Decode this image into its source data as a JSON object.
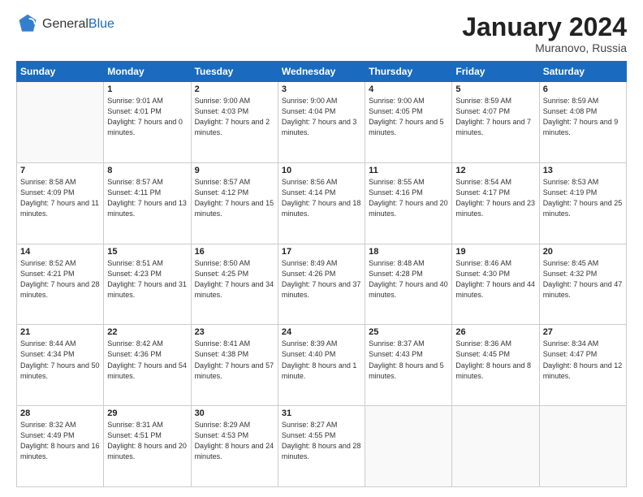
{
  "logo": {
    "general": "General",
    "blue": "Blue"
  },
  "header": {
    "month_year": "January 2024",
    "location": "Muranovo, Russia"
  },
  "weekdays": [
    "Sunday",
    "Monday",
    "Tuesday",
    "Wednesday",
    "Thursday",
    "Friday",
    "Saturday"
  ],
  "weeks": [
    [
      {
        "day": "",
        "sunrise": "",
        "sunset": "",
        "daylight": ""
      },
      {
        "day": "1",
        "sunrise": "Sunrise: 9:01 AM",
        "sunset": "Sunset: 4:01 PM",
        "daylight": "Daylight: 7 hours and 0 minutes."
      },
      {
        "day": "2",
        "sunrise": "Sunrise: 9:00 AM",
        "sunset": "Sunset: 4:03 PM",
        "daylight": "Daylight: 7 hours and 2 minutes."
      },
      {
        "day": "3",
        "sunrise": "Sunrise: 9:00 AM",
        "sunset": "Sunset: 4:04 PM",
        "daylight": "Daylight: 7 hours and 3 minutes."
      },
      {
        "day": "4",
        "sunrise": "Sunrise: 9:00 AM",
        "sunset": "Sunset: 4:05 PM",
        "daylight": "Daylight: 7 hours and 5 minutes."
      },
      {
        "day": "5",
        "sunrise": "Sunrise: 8:59 AM",
        "sunset": "Sunset: 4:07 PM",
        "daylight": "Daylight: 7 hours and 7 minutes."
      },
      {
        "day": "6",
        "sunrise": "Sunrise: 8:59 AM",
        "sunset": "Sunset: 4:08 PM",
        "daylight": "Daylight: 7 hours and 9 minutes."
      }
    ],
    [
      {
        "day": "7",
        "sunrise": "Sunrise: 8:58 AM",
        "sunset": "Sunset: 4:09 PM",
        "daylight": "Daylight: 7 hours and 11 minutes."
      },
      {
        "day": "8",
        "sunrise": "Sunrise: 8:57 AM",
        "sunset": "Sunset: 4:11 PM",
        "daylight": "Daylight: 7 hours and 13 minutes."
      },
      {
        "day": "9",
        "sunrise": "Sunrise: 8:57 AM",
        "sunset": "Sunset: 4:12 PM",
        "daylight": "Daylight: 7 hours and 15 minutes."
      },
      {
        "day": "10",
        "sunrise": "Sunrise: 8:56 AM",
        "sunset": "Sunset: 4:14 PM",
        "daylight": "Daylight: 7 hours and 18 minutes."
      },
      {
        "day": "11",
        "sunrise": "Sunrise: 8:55 AM",
        "sunset": "Sunset: 4:16 PM",
        "daylight": "Daylight: 7 hours and 20 minutes."
      },
      {
        "day": "12",
        "sunrise": "Sunrise: 8:54 AM",
        "sunset": "Sunset: 4:17 PM",
        "daylight": "Daylight: 7 hours and 23 minutes."
      },
      {
        "day": "13",
        "sunrise": "Sunrise: 8:53 AM",
        "sunset": "Sunset: 4:19 PM",
        "daylight": "Daylight: 7 hours and 25 minutes."
      }
    ],
    [
      {
        "day": "14",
        "sunrise": "Sunrise: 8:52 AM",
        "sunset": "Sunset: 4:21 PM",
        "daylight": "Daylight: 7 hours and 28 minutes."
      },
      {
        "day": "15",
        "sunrise": "Sunrise: 8:51 AM",
        "sunset": "Sunset: 4:23 PM",
        "daylight": "Daylight: 7 hours and 31 minutes."
      },
      {
        "day": "16",
        "sunrise": "Sunrise: 8:50 AM",
        "sunset": "Sunset: 4:25 PM",
        "daylight": "Daylight: 7 hours and 34 minutes."
      },
      {
        "day": "17",
        "sunrise": "Sunrise: 8:49 AM",
        "sunset": "Sunset: 4:26 PM",
        "daylight": "Daylight: 7 hours and 37 minutes."
      },
      {
        "day": "18",
        "sunrise": "Sunrise: 8:48 AM",
        "sunset": "Sunset: 4:28 PM",
        "daylight": "Daylight: 7 hours and 40 minutes."
      },
      {
        "day": "19",
        "sunrise": "Sunrise: 8:46 AM",
        "sunset": "Sunset: 4:30 PM",
        "daylight": "Daylight: 7 hours and 44 minutes."
      },
      {
        "day": "20",
        "sunrise": "Sunrise: 8:45 AM",
        "sunset": "Sunset: 4:32 PM",
        "daylight": "Daylight: 7 hours and 47 minutes."
      }
    ],
    [
      {
        "day": "21",
        "sunrise": "Sunrise: 8:44 AM",
        "sunset": "Sunset: 4:34 PM",
        "daylight": "Daylight: 7 hours and 50 minutes."
      },
      {
        "day": "22",
        "sunrise": "Sunrise: 8:42 AM",
        "sunset": "Sunset: 4:36 PM",
        "daylight": "Daylight: 7 hours and 54 minutes."
      },
      {
        "day": "23",
        "sunrise": "Sunrise: 8:41 AM",
        "sunset": "Sunset: 4:38 PM",
        "daylight": "Daylight: 7 hours and 57 minutes."
      },
      {
        "day": "24",
        "sunrise": "Sunrise: 8:39 AM",
        "sunset": "Sunset: 4:40 PM",
        "daylight": "Daylight: 8 hours and 1 minute."
      },
      {
        "day": "25",
        "sunrise": "Sunrise: 8:37 AM",
        "sunset": "Sunset: 4:43 PM",
        "daylight": "Daylight: 8 hours and 5 minutes."
      },
      {
        "day": "26",
        "sunrise": "Sunrise: 8:36 AM",
        "sunset": "Sunset: 4:45 PM",
        "daylight": "Daylight: 8 hours and 8 minutes."
      },
      {
        "day": "27",
        "sunrise": "Sunrise: 8:34 AM",
        "sunset": "Sunset: 4:47 PM",
        "daylight": "Daylight: 8 hours and 12 minutes."
      }
    ],
    [
      {
        "day": "28",
        "sunrise": "Sunrise: 8:32 AM",
        "sunset": "Sunset: 4:49 PM",
        "daylight": "Daylight: 8 hours and 16 minutes."
      },
      {
        "day": "29",
        "sunrise": "Sunrise: 8:31 AM",
        "sunset": "Sunset: 4:51 PM",
        "daylight": "Daylight: 8 hours and 20 minutes."
      },
      {
        "day": "30",
        "sunrise": "Sunrise: 8:29 AM",
        "sunset": "Sunset: 4:53 PM",
        "daylight": "Daylight: 8 hours and 24 minutes."
      },
      {
        "day": "31",
        "sunrise": "Sunrise: 8:27 AM",
        "sunset": "Sunset: 4:55 PM",
        "daylight": "Daylight: 8 hours and 28 minutes."
      },
      {
        "day": "",
        "sunrise": "",
        "sunset": "",
        "daylight": ""
      },
      {
        "day": "",
        "sunrise": "",
        "sunset": "",
        "daylight": ""
      },
      {
        "day": "",
        "sunrise": "",
        "sunset": "",
        "daylight": ""
      }
    ]
  ]
}
